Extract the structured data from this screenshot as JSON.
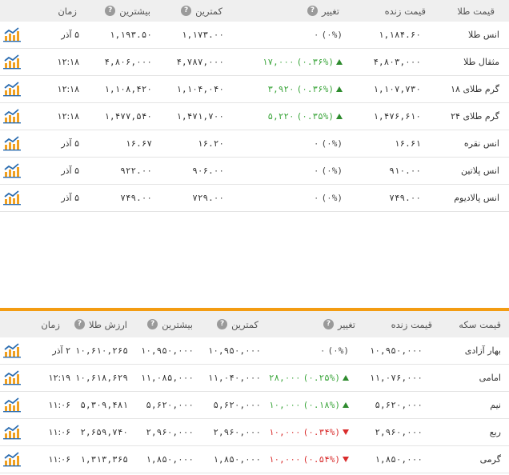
{
  "gold": {
    "headers": {
      "name": "قیمت طلا",
      "live": "قیمت زنده",
      "change": "تغییر",
      "low": "کمترین",
      "high": "بیشترین",
      "time": "زمان"
    },
    "rows": [
      {
        "name": "انس طلا",
        "live": "۱,۱۸۴.۶۰",
        "change": "۰",
        "pct": "(۰%)",
        "dir": "zero",
        "low": "۱,۱۷۳.۰۰",
        "high": "۱,۱۹۳.۵۰",
        "time": "۵ آذر"
      },
      {
        "name": "مثقال طلا",
        "live": "۴,۸۰۳,۰۰۰",
        "change": "۱۷,۰۰۰",
        "pct": "(۰.۳۶%)",
        "dir": "up",
        "low": "۴,۷۸۷,۰۰۰",
        "high": "۴,۸۰۶,۰۰۰",
        "time": "۱۲:۱۸"
      },
      {
        "name": "گرم طلای ۱۸",
        "live": "۱,۱۰۷,۷۳۰",
        "change": "۳,۹۲۰",
        "pct": "(۰.۳۶%)",
        "dir": "up",
        "low": "۱,۱۰۴,۰۴۰",
        "high": "۱,۱۰۸,۴۲۰",
        "time": "۱۲:۱۸"
      },
      {
        "name": "گرم طلای ۲۴",
        "live": "۱,۴۷۶,۶۱۰",
        "change": "۵,۲۲۰",
        "pct": "(۰.۳۵%)",
        "dir": "up",
        "low": "۱,۴۷۱,۷۰۰",
        "high": "۱,۴۷۷,۵۴۰",
        "time": "۱۲:۱۸"
      },
      {
        "name": "انس نقره",
        "live": "۱۶.۶۱",
        "change": "۰",
        "pct": "(۰%)",
        "dir": "zero",
        "low": "۱۶.۲۰",
        "high": "۱۶.۶۷",
        "time": "۵ آذر"
      },
      {
        "name": "انس پلاتین",
        "live": "۹۱۰.۰۰",
        "change": "۰",
        "pct": "(۰%)",
        "dir": "zero",
        "low": "۹۰۶.۰۰",
        "high": "۹۲۲.۰۰",
        "time": "۵ آذر"
      },
      {
        "name": "انس پالادیوم",
        "live": "۷۴۹.۰۰",
        "change": "۰",
        "pct": "(۰%)",
        "dir": "zero",
        "low": "۷۲۹.۰۰",
        "high": "۷۴۹.۰۰",
        "time": "۵ آذر"
      }
    ]
  },
  "coin": {
    "headers": {
      "name": "قیمت سکه",
      "live": "قیمت زنده",
      "change": "تغییر",
      "low": "کمترین",
      "high": "بیشترین",
      "gold_value": "ارزش طلا",
      "time": "زمان"
    },
    "rows": [
      {
        "name": "بهار آزادی",
        "live": "۱۰,۹۵۰,۰۰۰",
        "change": "۰",
        "pct": "(۰%)",
        "dir": "zero",
        "low": "۱۰,۹۵۰,۰۰۰",
        "high": "۱۰,۹۵۰,۰۰۰",
        "gold_value": "۱۰,۶۱۰,۲۶۵",
        "time": "۲ آذر"
      },
      {
        "name": "امامی",
        "live": "۱۱,۰۷۶,۰۰۰",
        "change": "۲۸,۰۰۰",
        "pct": "(۰.۲۵%)",
        "dir": "up",
        "low": "۱۱,۰۴۰,۰۰۰",
        "high": "۱۱,۰۸۵,۰۰۰",
        "gold_value": "۱۰,۶۱۸,۶۲۹",
        "time": "۱۲:۱۹"
      },
      {
        "name": "نیم",
        "live": "۵,۶۲۰,۰۰۰",
        "change": "۱۰,۰۰۰",
        "pct": "(۰.۱۸%)",
        "dir": "up",
        "low": "۵,۶۲۰,۰۰۰",
        "high": "۵,۶۲۰,۰۰۰",
        "gold_value": "۵,۳۰۹,۴۸۱",
        "time": "۱۱:۰۶"
      },
      {
        "name": "ربع",
        "live": "۲,۹۶۰,۰۰۰",
        "change": "۱۰,۰۰۰",
        "pct": "(۰.۳۴%)",
        "dir": "down",
        "low": "۲,۹۶۰,۰۰۰",
        "high": "۲,۹۶۰,۰۰۰",
        "gold_value": "۲,۶۵۹,۷۴۰",
        "time": "۱۱:۰۶"
      },
      {
        "name": "گرمی",
        "live": "۱,۸۵۰,۰۰۰",
        "change": "۱۰,۰۰۰",
        "pct": "(۰.۵۴%)",
        "dir": "down",
        "low": "۱,۸۵۰,۰۰۰",
        "high": "۱,۸۵۰,۰۰۰",
        "gold_value": "۱,۳۱۳,۳۶۵",
        "time": "۱۱:۰۶"
      }
    ]
  },
  "icons": {
    "help": "question-circle-icon",
    "chart": "chart-icon"
  },
  "colors": {
    "up": "#3aa53a",
    "down": "#d92c2c",
    "accent": "#f39c12",
    "chart_icon": "#f0a020"
  }
}
